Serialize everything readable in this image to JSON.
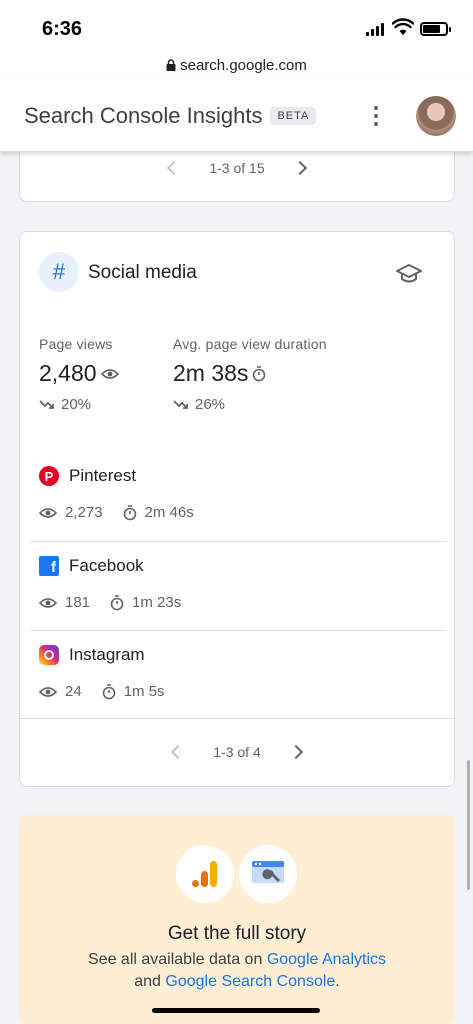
{
  "status_bar": {
    "time": "6:36"
  },
  "browser": {
    "url": "search.google.com"
  },
  "header": {
    "title": "Search Console Insights",
    "badge": "BETA"
  },
  "top_card": {
    "pagination": "1-3 of 15"
  },
  "social_card": {
    "title": "Social media",
    "metrics": [
      {
        "label": "Page views",
        "value": "2,480",
        "change": "20%",
        "trend": "down"
      },
      {
        "label": "Avg. page view duration",
        "value": "2m 38s",
        "change": "26%",
        "trend": "down"
      }
    ],
    "rows": [
      {
        "name": "Pinterest",
        "views": "2,273",
        "duration": "2m 46s"
      },
      {
        "name": "Facebook",
        "views": "181",
        "duration": "1m 23s"
      },
      {
        "name": "Instagram",
        "views": "24",
        "duration": "1m 5s"
      }
    ],
    "pagination": "1-3 of 4"
  },
  "promo": {
    "title": "Get the full story",
    "text_1": "See all available data on",
    "link_1": "Google Analytics",
    "text_2": "and",
    "link_2": "Google Search Console",
    "text_3": "."
  },
  "colors": {
    "accent": "#1a73e8",
    "promo_bg": "#fdeed4"
  }
}
